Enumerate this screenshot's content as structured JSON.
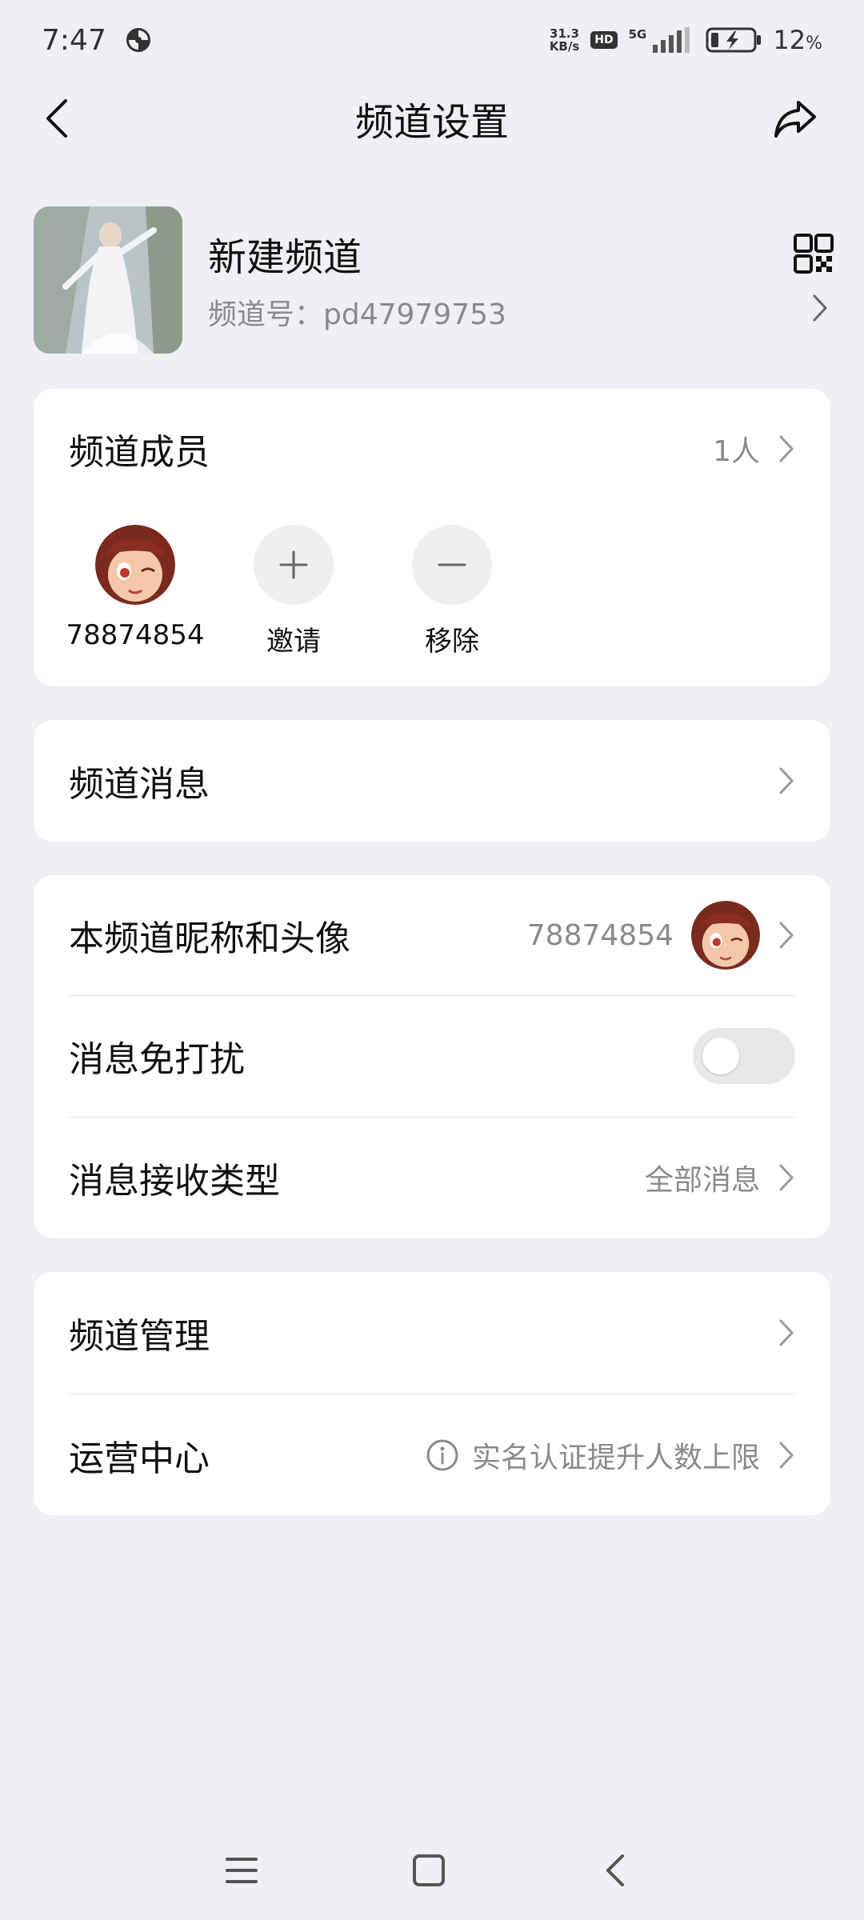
{
  "status_bar": {
    "time": "7:47",
    "net_speed_value": "31.3",
    "net_speed_unit": "KB/s",
    "hd_label": "HD",
    "network_label": "5G",
    "battery_percent": "12",
    "battery_unit": "%"
  },
  "topbar": {
    "title": "频道设置"
  },
  "channel": {
    "name": "新建频道",
    "id_text": "频道号：pd47979753"
  },
  "members_card": {
    "title": "频道成员",
    "count": "1人",
    "members": [
      {
        "label": "78874854"
      },
      {
        "label": "邀请"
      },
      {
        "label": "移除"
      }
    ]
  },
  "messages_card": {
    "label": "频道消息"
  },
  "profile_card": {
    "nickname_label": "本频道昵称和头像",
    "nickname_value": "78874854",
    "dnd_label": "消息免打扰",
    "dnd_on": false,
    "receive_type_label": "消息接收类型",
    "receive_type_value": "全部消息"
  },
  "manage_card": {
    "manage_label": "频道管理",
    "ops_label": "运营中心",
    "ops_hint": "实名认证提升人数上限"
  },
  "colors": {
    "background": "#efeff4",
    "card": "#ffffff",
    "secondary_text": "#8a8a8e"
  }
}
